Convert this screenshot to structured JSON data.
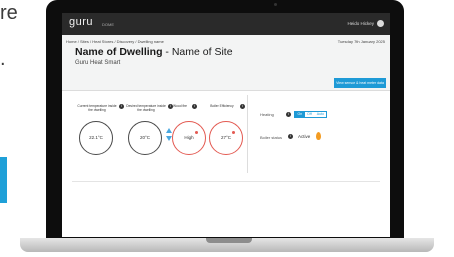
{
  "side_text": {
    "line1": "re",
    "line2": "."
  },
  "header": {
    "logo": "guru",
    "logo_sub": "DOME",
    "user_name": "Heido Hickey"
  },
  "sub": {
    "breadcrumb": "Home / Sites / Heat Stores / Discovery / Dwelling name",
    "date": "Tuesday 7th January 2025",
    "title_bold": "Name of Dwelling",
    "title_rest": " - Name of Site",
    "subtitle": "Guru Heat Smart",
    "primary_button": "View sensor & heat meter data"
  },
  "dials": [
    {
      "label": "Current temperature inside the dwelling",
      "value": "22.1°C"
    },
    {
      "label": "Desired temperature inside the dwelling",
      "value": "20°C"
    },
    {
      "label": "Wood fire",
      "value": "High"
    },
    {
      "label": "Boiler Efficiency",
      "value": "27°C"
    }
  ],
  "heating": {
    "label": "Heating",
    "options": [
      "On",
      "Off",
      "Auto"
    ],
    "selected": "On"
  },
  "boiler_status": {
    "label": "Boiler status",
    "value": "Active"
  },
  "colors": {
    "accent": "#1e9ad6",
    "alert": "#e35a52",
    "flame": "#f39b21",
    "header_bg": "#2a2a2a"
  },
  "icons": [
    "user-icon",
    "info-icon",
    "arrow-up-icon",
    "arrow-down-icon",
    "flame-icon"
  ]
}
